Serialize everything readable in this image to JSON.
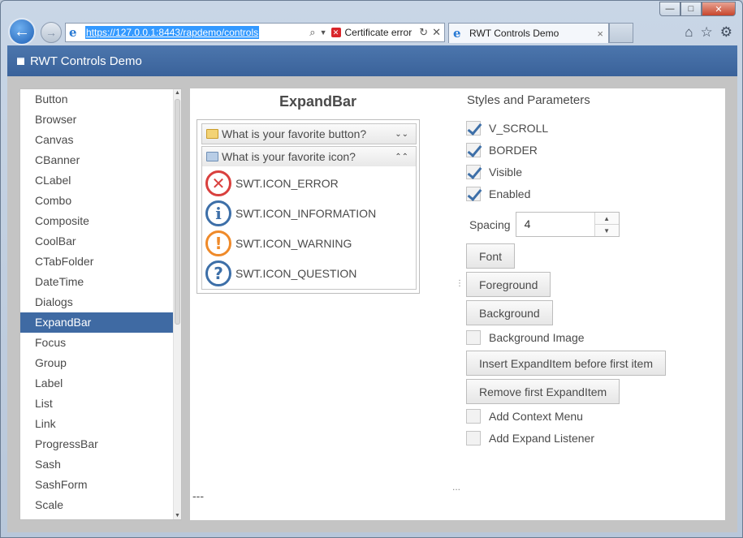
{
  "browser": {
    "url": "https://127.0.0.1:8443/rapdemo/controls",
    "certificate_error": "Certificate error",
    "tab_title": "RWT Controls Demo",
    "tab_close": "×",
    "win_minimize": "—",
    "win_maximize": "□",
    "win_close": "✕"
  },
  "app": {
    "title": "RWT Controls Demo"
  },
  "nav": {
    "items": [
      "Button",
      "Browser",
      "Canvas",
      "CBanner",
      "CLabel",
      "Combo",
      "Composite",
      "CoolBar",
      "CTabFolder",
      "DateTime",
      "Dialogs",
      "ExpandBar",
      "Focus",
      "Group",
      "Label",
      "List",
      "Link",
      "ProgressBar",
      "Sash",
      "SashForm",
      "Scale"
    ],
    "selected": "ExpandBar"
  },
  "demo": {
    "title": "ExpandBar",
    "items": [
      {
        "label": "What is your favorite button?",
        "expanded": false
      },
      {
        "label": "What is your favorite icon?",
        "expanded": true
      }
    ],
    "icons": [
      {
        "name": "error",
        "glyph": "✕",
        "label": "SWT.ICON_ERROR",
        "color": "#d9403e"
      },
      {
        "name": "information",
        "glyph": "i",
        "label": "SWT.ICON_INFORMATION",
        "color": "#3d6fa8"
      },
      {
        "name": "warning",
        "glyph": "!",
        "label": "SWT.ICON_WARNING",
        "color": "#ef8a2a"
      },
      {
        "name": "question",
        "glyph": "?",
        "label": "SWT.ICON_QUESTION",
        "color": "#3d6fa8"
      }
    ],
    "status": "---",
    "sash_handle": "⋮",
    "bottom_handle": "..."
  },
  "params": {
    "title": "Styles and Parameters",
    "checks": [
      {
        "label": "V_SCROLL",
        "checked": true
      },
      {
        "label": "BORDER",
        "checked": true
      },
      {
        "label": "Visible",
        "checked": true
      },
      {
        "label": "Enabled",
        "checked": true
      }
    ],
    "spacing_label": "Spacing",
    "spacing_value": "4",
    "buttons": {
      "font": "Font",
      "foreground": "Foreground",
      "background": "Background",
      "insert": "Insert ExpandItem before first item",
      "remove": "Remove first ExpandItem"
    },
    "checks2": [
      {
        "label": "Background Image",
        "checked": false
      },
      {
        "label": "Add Context Menu",
        "checked": false
      },
      {
        "label": "Add Expand Listener",
        "checked": false
      }
    ]
  },
  "colors": {
    "accent": "#3f6aa3",
    "header": "#4269a0"
  }
}
